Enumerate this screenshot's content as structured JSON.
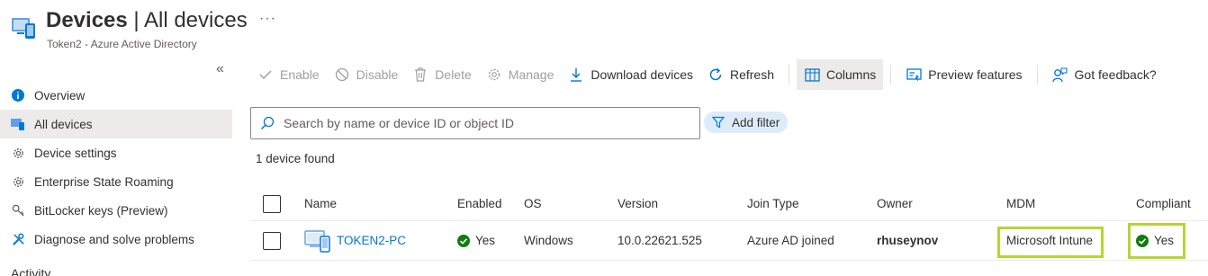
{
  "header": {
    "title_bold": "Devices",
    "title_rest": " | All devices",
    "subtitle": "Token2 - Azure Active Directory",
    "more": "···"
  },
  "sidebar": {
    "collapse": "«",
    "items": [
      {
        "label": "Overview",
        "icon": "info-icon"
      },
      {
        "label": "All devices",
        "icon": "devices-icon",
        "active": true
      },
      {
        "label": "Device settings",
        "icon": "gear-icon"
      },
      {
        "label": "Enterprise State Roaming",
        "icon": "gear-icon"
      },
      {
        "label": "BitLocker keys (Preview)",
        "icon": "key-icon"
      },
      {
        "label": "Diagnose and solve problems",
        "icon": "wrench-icon"
      }
    ],
    "section_heading": "Activity"
  },
  "toolbar": {
    "enable": "Enable",
    "disable": "Disable",
    "delete": "Delete",
    "manage": "Manage",
    "download": "Download devices",
    "refresh": "Refresh",
    "columns": "Columns",
    "preview": "Preview features",
    "feedback": "Got feedback?"
  },
  "search": {
    "placeholder": "Search by name or device ID or object ID",
    "value": ""
  },
  "filter": {
    "label": "Add filter"
  },
  "results": {
    "count_text": "1 device found"
  },
  "table": {
    "headers": {
      "name": "Name",
      "enabled": "Enabled",
      "os": "OS",
      "version": "Version",
      "join_type": "Join Type",
      "owner": "Owner",
      "mdm": "MDM",
      "compliant": "Compliant"
    },
    "rows": [
      {
        "name": "TOKEN2-PC",
        "enabled": "Yes",
        "os": "Windows",
        "version": "10.0.22621.525",
        "join_type": "Azure AD joined",
        "owner": "rhuseynov",
        "mdm": "Microsoft Intune",
        "compliant": "Yes"
      }
    ]
  },
  "colors": {
    "accent": "#0078d4",
    "success": "#107c10",
    "highlight": "#b8d432",
    "selected_bg": "#edebe9",
    "filter_bg": "#deecf9"
  }
}
